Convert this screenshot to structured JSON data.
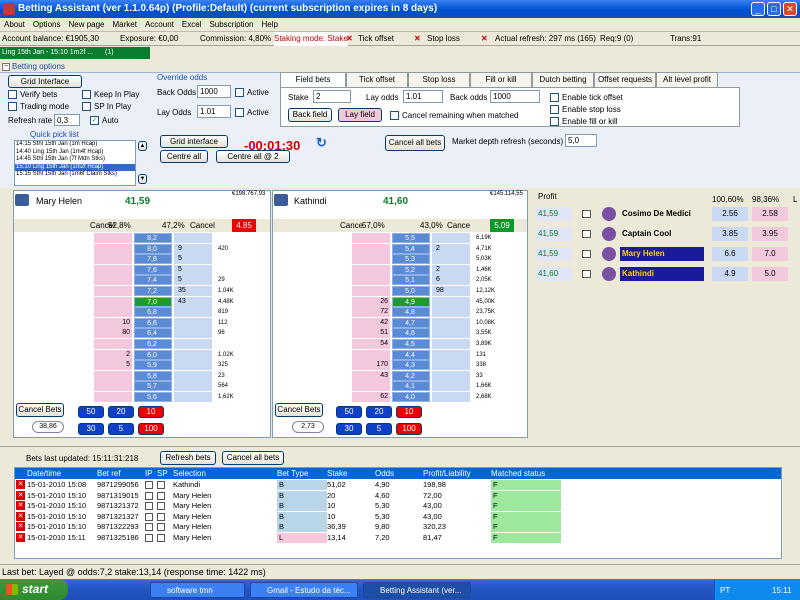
{
  "window": {
    "title": "Betting Assistant (ver 1.1.0.64p)      (Profile:Default)      (current subscription expires in 8 days)"
  },
  "menu": [
    "About",
    "Options",
    "New page",
    "Market",
    "Account",
    "Excel",
    "Subscription",
    "Help"
  ],
  "info": {
    "balance": "Account balance: €1905,30",
    "exposure": "Exposure: €0,00",
    "commission": "Commission: 4,80%",
    "staking": "Staking mode: Stake",
    "tick_offset": "Tick offset",
    "stop_loss": "Stop loss",
    "refresh": "Actual refresh: 297 ms (165)",
    "req": "Req:9 (0)",
    "trans": "Trans:91"
  },
  "market": {
    "name": "Ling 15th Jan - 15:10 1m2f ...",
    "count": "(1)"
  },
  "betting_options": {
    "header": "Betting options",
    "grid_interface": "Grid Interface",
    "verify_bets": "Verify bets",
    "keep_in_play": "Keep In Play",
    "trading_mode": "Trading mode",
    "sp_in_play": "SP In Play",
    "refresh_rate_label": "Refresh rate",
    "refresh_rate": "0,3",
    "auto": "Auto",
    "override_title": "Override odds",
    "back_odds_label": "Back Odds",
    "back_odds": "1000",
    "lay_odds_label": "Lay Odds",
    "lay_odds": "1.01",
    "active": "Active"
  },
  "tabs": [
    "Field bets",
    "Tick offset",
    "Stop loss",
    "Fill or kill",
    "Dutch betting",
    "Offset requests",
    "Alt level profit"
  ],
  "field_bets": {
    "stake_label": "Stake",
    "stake": "2",
    "lay_odds_label": "Lay odds",
    "lay_odds": "1.01",
    "back_odds_label": "Back odds",
    "back_odds": "1000",
    "back_field": "Back field",
    "lay_field": "Lay field",
    "cancel_remaining": "Cancel remaining when matched",
    "enable_tick": "Enable tick offset",
    "enable_stop": "Enable stop loss",
    "enable_fill": "Enable fill or kill"
  },
  "quick_pick": {
    "title": "Quick pick list",
    "items": [
      "14:15 Sthl 15th Jan (1m Hcap)",
      "14:40 Ling 15th Jan (1m4f Hcap)",
      "14:45 Sthl 15th Jan (7f Mdn Stks)",
      "15:10 Ling 15th Jan (1m2f Hcap)",
      "15:15 Sthl 15th Jan (1m6f Claim Stks)"
    ],
    "selected": 3
  },
  "controls": {
    "grid_interface": "Grid interface",
    "timer": "-00:01:30",
    "centre_all": "Centre all",
    "centre_all_2": "Centre all @ 2",
    "cancel_all": "Cancel all bets",
    "depth_label": "Market depth refresh (seconds)",
    "depth_value": "5,0"
  },
  "ladder_left": {
    "runner": "Mary Helen",
    "ltp": "41,59",
    "matched": "€198.767,93",
    "cancel": "Cancel",
    "back_pct": "52,8%",
    "lay_pct": "47,2%",
    "cancel2": "Cancel",
    "last": "4.85",
    "rows": [
      {
        "left": "",
        "lay": "",
        "odds": "8,2",
        "back": "",
        "right": ""
      },
      {
        "left": "",
        "lay": "",
        "odds": "8,0",
        "back": "9",
        "right": "420"
      },
      {
        "left": "",
        "lay": "",
        "odds": "7,8",
        "back": "5",
        "right": ""
      },
      {
        "left": "",
        "lay": "",
        "odds": "7,6",
        "back": "5",
        "right": ""
      },
      {
        "left": "",
        "lay": "",
        "odds": "7,4",
        "back": "5",
        "right": "29"
      },
      {
        "left": "",
        "lay": "",
        "odds": "7,2",
        "back": "35",
        "right": "1,04K"
      },
      {
        "left": "",
        "lay": "",
        "odds": "7,0",
        "back": "43",
        "right": "4,48K"
      },
      {
        "left": "",
        "lay": "",
        "odds": "6,8",
        "back": "",
        "right": "819"
      },
      {
        "left": "",
        "lay": "10",
        "odds": "6,6",
        "back": "",
        "right": "112"
      },
      {
        "left": "",
        "lay": "80",
        "odds": "6,4",
        "back": "",
        "right": "96"
      },
      {
        "left": "",
        "lay": "",
        "odds": "6,2",
        "back": "",
        "right": ""
      },
      {
        "left": "",
        "lay": "2",
        "odds": "6,0",
        "back": "",
        "right": "1,02K"
      },
      {
        "left": "",
        "lay": "5",
        "odds": "5,9",
        "back": "",
        "right": "325"
      },
      {
        "left": "",
        "lay": "",
        "odds": "5,8",
        "back": "",
        "right": "23"
      },
      {
        "left": "",
        "lay": "",
        "odds": "5,7",
        "back": "",
        "right": "564"
      },
      {
        "left": "",
        "lay": "",
        "odds": "5,6",
        "back": "",
        "right": "1,62K"
      }
    ],
    "cancel_bets": "Cancel Bets",
    "stakes": [
      "50",
      "20",
      "10",
      "30",
      "5",
      "100"
    ],
    "pl": "38,86"
  },
  "ladder_right": {
    "runner": "Kathindi",
    "ltp": "41,60",
    "matched": "€145.114,55",
    "cancel": "Cance",
    "back_pct": "57,0%",
    "lay_pct": "43,0%",
    "cancel2": "Cance",
    "last": "5.09",
    "rows": [
      {
        "lay": "",
        "odds": "5,5",
        "back": "",
        "right": "6,19K"
      },
      {
        "lay": "",
        "odds": "5,4",
        "back": "2",
        "right": "4,71K"
      },
      {
        "lay": "",
        "odds": "5,3",
        "back": "",
        "right": "5,03K"
      },
      {
        "lay": "",
        "odds": "5,2",
        "back": "2",
        "right": "1,46K"
      },
      {
        "lay": "",
        "odds": "5,1",
        "back": "6",
        "right": "2,05K"
      },
      {
        "lay": "",
        "odds": "5,0",
        "back": "98",
        "right": "12,12K"
      },
      {
        "lay": "26",
        "odds": "4,9",
        "back": "",
        "right": "45,00K"
      },
      {
        "lay": "72",
        "odds": "4,8",
        "back": "",
        "right": "23,75K"
      },
      {
        "lay": "42",
        "odds": "4,7",
        "back": "",
        "right": "10,08K"
      },
      {
        "lay": "51",
        "odds": "4,6",
        "back": "",
        "right": "3,55K"
      },
      {
        "lay": "54",
        "odds": "4,5",
        "back": "",
        "right": "3,89K"
      },
      {
        "lay": "",
        "odds": "4,4",
        "back": "",
        "right": "131"
      },
      {
        "lay": "170",
        "odds": "4,3",
        "back": "",
        "right": "338"
      },
      {
        "lay": "43",
        "odds": "4,2",
        "back": "",
        "right": "33"
      },
      {
        "lay": "",
        "odds": "4,1",
        "back": "",
        "right": "1,66K"
      },
      {
        "lay": "62",
        "odds": "4,0",
        "back": "",
        "right": "2,68K"
      }
    ],
    "cancel_bets": "Cancel Bets",
    "stakes": [
      "50",
      "20",
      "10",
      "30",
      "5",
      "100"
    ],
    "pl": "2,73"
  },
  "profit_panel": {
    "title": "Profit",
    "pct1": "100,60%",
    "pct2": "98,36%",
    "col_l": "L",
    "runners": [
      {
        "profit": "41,59",
        "name": "Cosimo De Medici",
        "back": "2.56",
        "lay": "2.58"
      },
      {
        "profit": "41,59",
        "name": "Captain Cool",
        "back": "3.85",
        "lay": "3.95"
      },
      {
        "profit": "41,59",
        "name": "Mary Helen",
        "back": "6.6",
        "lay": "7.0"
      },
      {
        "profit": "41,60",
        "name": "Kathindi",
        "back": "4.9",
        "lay": "5.0"
      }
    ]
  },
  "bets": {
    "last_updated": "Bets last updated: 15:11:31:218",
    "refresh": "Refresh bets",
    "cancel_all": "Cancel all bets",
    "columns": [
      "Date/time",
      "Bet ref",
      "IP",
      "SP",
      "Selection",
      "Bet Type",
      "Stake",
      "Odds",
      "Profit/Liability",
      "Matched status"
    ],
    "rows": [
      [
        "15-01-2010 15:08",
        "9871299056",
        "",
        "",
        "Kathindi",
        "B",
        "51,02",
        "4,90",
        "198,98",
        "F"
      ],
      [
        "15-01-2010 15:10",
        "9871319015",
        "",
        "",
        "Mary Helen",
        "B",
        "20",
        "4,60",
        "72,00",
        "F"
      ],
      [
        "15-01-2010 15:10",
        "9871321372",
        "",
        "",
        "Mary Helen",
        "B",
        "10",
        "5,30",
        "43,00",
        "F"
      ],
      [
        "15-01-2010 15:10",
        "9871321327",
        "",
        "",
        "Mary Helen",
        "B",
        "10",
        "5,30",
        "43,00",
        "F"
      ],
      [
        "15-01-2010 15:10",
        "9871322293",
        "",
        "",
        "Mary Helen",
        "B",
        "36,39",
        "9,80",
        "320,23",
        "F"
      ],
      [
        "15-01-2010 15:11",
        "9871325186",
        "",
        "",
        "Mary Helen",
        "L",
        "13,14",
        "7,20",
        "81,47",
        "F"
      ]
    ]
  },
  "status": "Last bet: Layed  @ odds:7,2  stake:13,14  (response time: 1422 ms)",
  "taskbar": {
    "start": "start",
    "tasks": [
      "software tmn",
      "Gmail - Estudo da téc...",
      "Betting Assistant (ver..."
    ],
    "lang": "PT",
    "time": "15:11"
  }
}
